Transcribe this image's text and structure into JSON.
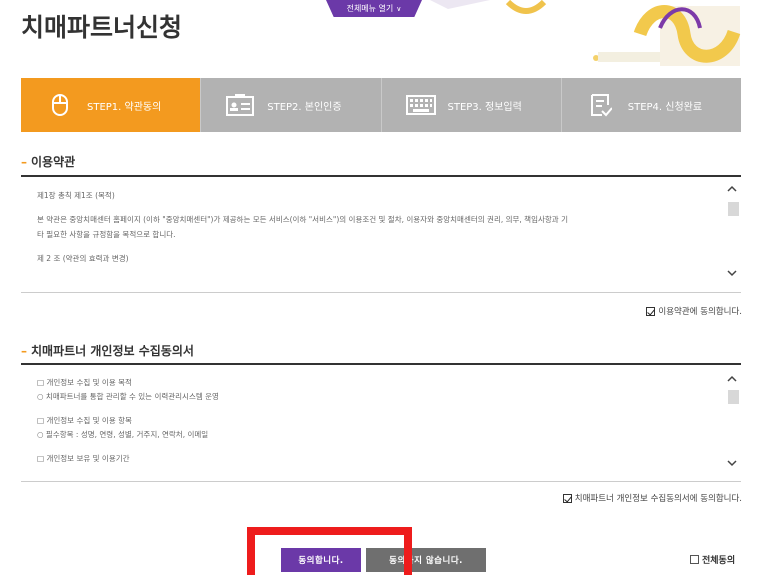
{
  "header": {
    "title": "치매파트너신청",
    "menu_toggle": "전체메뉴 열기",
    "menu_chevron": "∨"
  },
  "steps": [
    {
      "label": "STEP1. 약관동의",
      "icon": "mouse-icon",
      "active": true
    },
    {
      "label": "STEP2. 본인인증",
      "icon": "id-card-icon",
      "active": false
    },
    {
      "label": "STEP3. 정보입력",
      "icon": "keyboard-icon",
      "active": false
    },
    {
      "label": "STEP4. 신청완료",
      "icon": "document-check-icon",
      "active": false
    }
  ],
  "terms": {
    "title": "이용약관",
    "lines": [
      "제1장 총칙 제1조 (목적)",
      "",
      "본 약관은 중앙치매센터 홈페이지 (이하 \"중앙치매센터\")가 제공하는 모든 서비스(이하 \"서비스\")의 이용조건 및 절차, 이용자와 중앙치매센터의 권리, 의무, 책임사항과 기",
      "타 필요한 사항을 규정함을 목적으로 합니다.",
      "",
      "제 2 조 (약관의 효력과 변경)"
    ],
    "agree_label": "이용약관에 동의합니다.",
    "agree_checked": true
  },
  "privacy": {
    "title": "치매파트너 개인정보 수집동의서",
    "lines": [
      "□ 개인정보 수집 및 이용 목적",
      "  ○ 치매파트너를 통합 관리할 수 있는 이력관리시스템 운영",
      "",
      "□ 개인정보 수집 및 이용 항목",
      "  ○ 필수항목 : 성명, 연령, 성별, 거주지, 연락처, 이메일",
      "",
      "□ 개인정보 보유 및 이용기간"
    ],
    "agree_label": "치매파트너 개인정보 수집동의서에 동의합니다.",
    "agree_checked": true
  },
  "actions": {
    "agree_button": "동의합니다.",
    "disagree_button": "동의하지 않습니다.",
    "all_agree_label": "전체동의"
  },
  "colors": {
    "accent_orange": "#f39a1f",
    "brand_purple": "#6b39a8",
    "step_inactive": "#b2b2b2",
    "highlight_red": "#ee1c1c"
  }
}
